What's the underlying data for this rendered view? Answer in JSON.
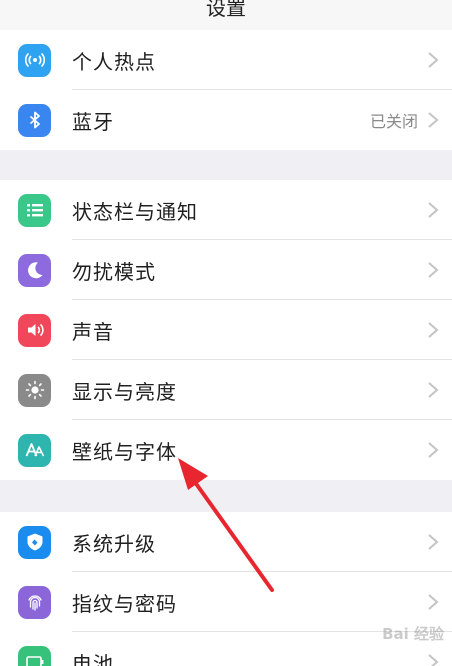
{
  "header": {
    "title": "设置"
  },
  "groups": [
    {
      "items": [
        {
          "label": "个人热点",
          "value": "",
          "icon": "hotspot-icon",
          "color": "#2ea3f2"
        },
        {
          "label": "蓝牙",
          "value": "已关闭",
          "icon": "bluetooth-icon",
          "color": "#3a86f0"
        }
      ]
    },
    {
      "items": [
        {
          "label": "状态栏与通知",
          "value": "",
          "icon": "statusbar-icon",
          "color": "#3ac78a"
        },
        {
          "label": "勿扰模式",
          "value": "",
          "icon": "moon-icon",
          "color": "#8e6adf"
        },
        {
          "label": "声音",
          "value": "",
          "icon": "speaker-icon",
          "color": "#f0485a"
        },
        {
          "label": "显示与亮度",
          "value": "",
          "icon": "brightness-icon",
          "color": "#8a8a8a"
        },
        {
          "label": "壁纸与字体",
          "value": "",
          "icon": "font-icon",
          "color": "#2fb5b0"
        }
      ]
    },
    {
      "items": [
        {
          "label": "系统升级",
          "value": "",
          "icon": "upgrade-icon",
          "color": "#1a8cf0"
        },
        {
          "label": "指纹与密码",
          "value": "",
          "icon": "fingerprint-icon",
          "color": "#8b66d9"
        },
        {
          "label": "电池",
          "value": "",
          "icon": "battery-icon",
          "color": "#36c27a"
        }
      ]
    }
  ],
  "annotation": {
    "arrow_color": "#e8262f"
  },
  "watermark": {
    "text": "Bai 经验"
  }
}
